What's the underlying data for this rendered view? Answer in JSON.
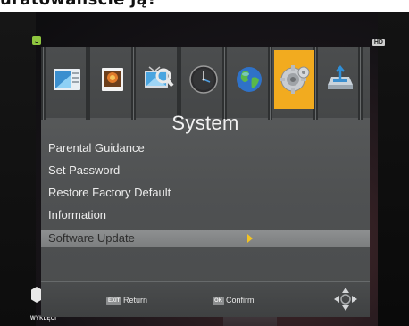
{
  "caption": "uratowaliście ją?",
  "screen": {
    "corner_label": "WYKLĘCI",
    "hd_label": "HD"
  },
  "menu": {
    "title": "System",
    "tabs": [
      {
        "icon": "picture-settings-icon",
        "active": false
      },
      {
        "icon": "media-photo-icon",
        "active": false
      },
      {
        "icon": "channel-search-icon",
        "active": false
      },
      {
        "icon": "clock-icon",
        "active": false
      },
      {
        "icon": "globe-icon",
        "active": false
      },
      {
        "icon": "gears-icon",
        "active": true
      },
      {
        "icon": "usb-icon",
        "active": false
      }
    ],
    "items": [
      {
        "label": "Parental Guidance",
        "selected": false
      },
      {
        "label": "Set Password",
        "selected": false
      },
      {
        "label": "Restore Factory Default",
        "selected": false
      },
      {
        "label": "Information",
        "selected": false
      },
      {
        "label": "Software Update",
        "selected": true
      }
    ],
    "footer": {
      "exit_key": "EXIT",
      "exit_label": "Return",
      "ok_key": "OK",
      "ok_label": "Confirm"
    },
    "colors": {
      "active_tab": "#f2ab1f",
      "selection_arrow": "#f3c322",
      "highlight": "#8e9091"
    }
  }
}
